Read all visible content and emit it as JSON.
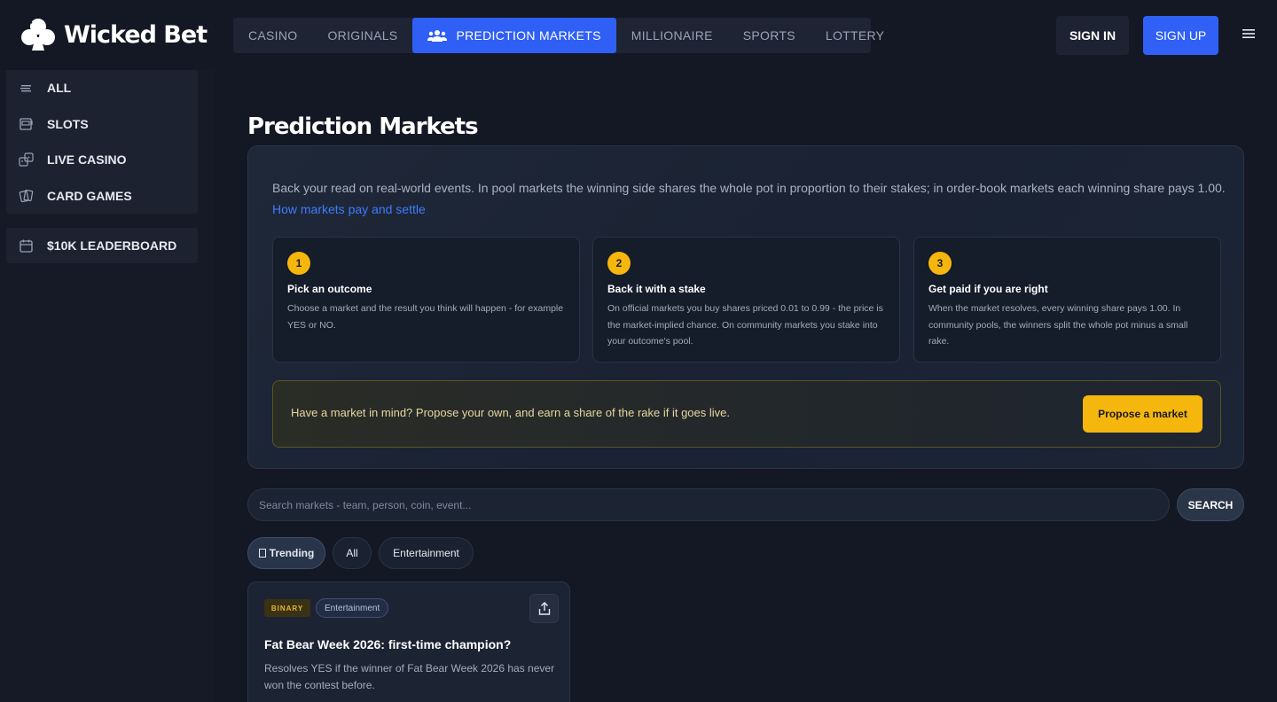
{
  "brand": {
    "name": "Wicked Bet"
  },
  "nav": {
    "items": [
      {
        "label": "CASINO"
      },
      {
        "label": "ORIGINALS"
      },
      {
        "label": "PREDICTION MARKETS",
        "active": true
      },
      {
        "label": "MILLIONAIRE"
      },
      {
        "label": "SPORTS"
      },
      {
        "label": "LOTTERY"
      }
    ]
  },
  "auth": {
    "signin": "SIGN IN",
    "signup": "SIGN UP"
  },
  "sidebar": {
    "items": [
      {
        "label": "ALL",
        "icon": "stack-icon"
      },
      {
        "label": "SLOTS",
        "icon": "slot-machine-icon"
      },
      {
        "label": "LIVE CASINO",
        "icon": "dice-icon"
      },
      {
        "label": "CARD GAMES",
        "icon": "cards-icon"
      }
    ],
    "leaderboard": {
      "label": "$10K LEADERBOARD",
      "icon": "calendar-icon"
    }
  },
  "page": {
    "title": "Prediction Markets",
    "intro": "Back your read on real-world events. In pool markets the winning side shares the whole pot in proportion to their stakes; in order-book markets each winning share pays 1.00.",
    "intro_link": "How markets pay and settle",
    "steps": [
      {
        "num": "1",
        "title": "Pick an outcome",
        "desc": "Choose a market and the result you think will happen - for example YES or NO."
      },
      {
        "num": "2",
        "title": "Back it with a stake",
        "desc": "On official markets you buy shares priced 0.01 to 0.99 - the price is the market-implied chance. On community markets you stake into your outcome's pool."
      },
      {
        "num": "3",
        "title": "Get paid if you are right",
        "desc": "When the market resolves, every winning share pays 1.00. In community pools, the winners split the whole pot minus a small rake."
      }
    ],
    "propose": {
      "text": "Have a market in mind? Propose your own, and earn a share of the rake if it goes live.",
      "button": "Propose a market"
    },
    "search": {
      "placeholder": "Search markets - team, person, coin, event...",
      "button": "SEARCH"
    },
    "filters": [
      {
        "label": "Trending",
        "active": true
      },
      {
        "label": "All"
      },
      {
        "label": "Entertainment"
      }
    ],
    "market": {
      "type": "BINARY",
      "category": "Entertainment",
      "title": "Fat Bear Week 2026: first-time champion?",
      "desc": "Resolves YES if the winner of Fat Bear Week 2026 has never won the contest before."
    }
  },
  "colors": {
    "accent": "#3060f6",
    "gold": "#f5b70e"
  }
}
